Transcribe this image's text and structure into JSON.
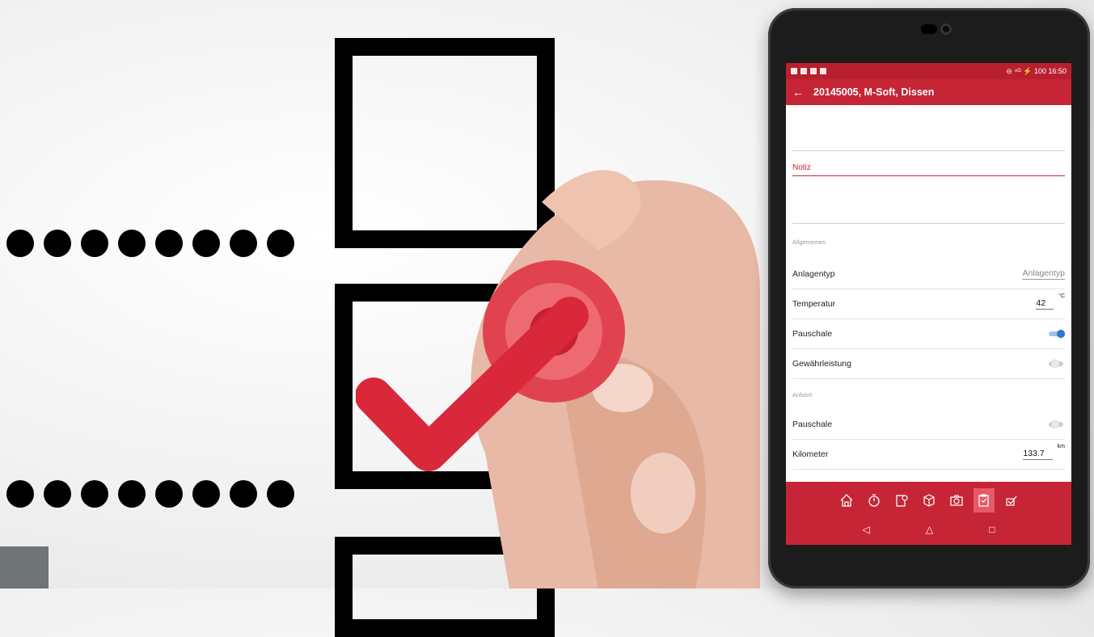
{
  "app": {
    "title": "20145005, M-Soft, Dissen",
    "back_icon": "arrow-left-icon",
    "status_right": "⊖ ⁴ᴳ ⚡ 100 16:50"
  },
  "form": {
    "notiz_label": "Notiz",
    "section_general": "Allgemeines",
    "section_travel": "Anfahrt",
    "rows": {
      "anlagentyp": {
        "label": "Anlagentyp",
        "placeholder": "Anlagentyp"
      },
      "temperatur": {
        "label": "Temperatur",
        "value": "42",
        "unit": "°C"
      },
      "pauschale": {
        "label": "Pauschale",
        "on": true
      },
      "gewaehrleistung": {
        "label": "Gewährleistung",
        "on": false
      },
      "anfahrt_pauschale": {
        "label": "Pauschale",
        "on": false
      },
      "kilometer": {
        "label": "Kilometer",
        "value": "133.7",
        "unit": "km"
      }
    }
  },
  "bottom_tabs": [
    "home-icon",
    "stopwatch-icon",
    "clipboard-clock-icon",
    "box-icon",
    "camera-icon",
    "clipboard-edit-icon",
    "checkbox-icon"
  ],
  "active_tab": "clipboard-edit-icon",
  "nav": {
    "back": "◁",
    "home": "△",
    "recent": "□"
  },
  "colors": {
    "brand": "#c62535",
    "checkmark": "#d9283a",
    "toggle_on": "#3377cc"
  }
}
